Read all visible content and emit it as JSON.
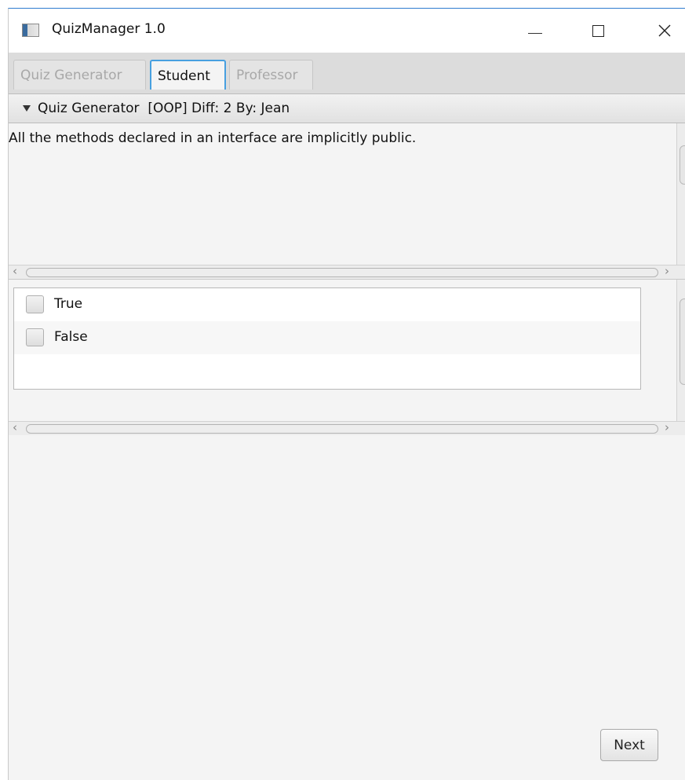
{
  "window": {
    "title": "QuizManager 1.0",
    "icon": "app-window-icon"
  },
  "tabs": [
    {
      "label": "Quiz Generator",
      "state": "disabled"
    },
    {
      "label": "Student",
      "state": "selected"
    },
    {
      "label": "Professor",
      "state": "disabled"
    }
  ],
  "pane": {
    "title": "Quiz Generator  [OOP] Diff: 2 By: Jean",
    "expanded": true
  },
  "question": {
    "text": "All the methods declared in an interface are implicitly public."
  },
  "answers": [
    {
      "label": "True",
      "checked": false
    },
    {
      "label": "False",
      "checked": false
    }
  ],
  "actions": {
    "next_label": "Next"
  },
  "colors": {
    "selected_tab_border": "#47a0e0",
    "window_background": "#f4f4f4"
  }
}
